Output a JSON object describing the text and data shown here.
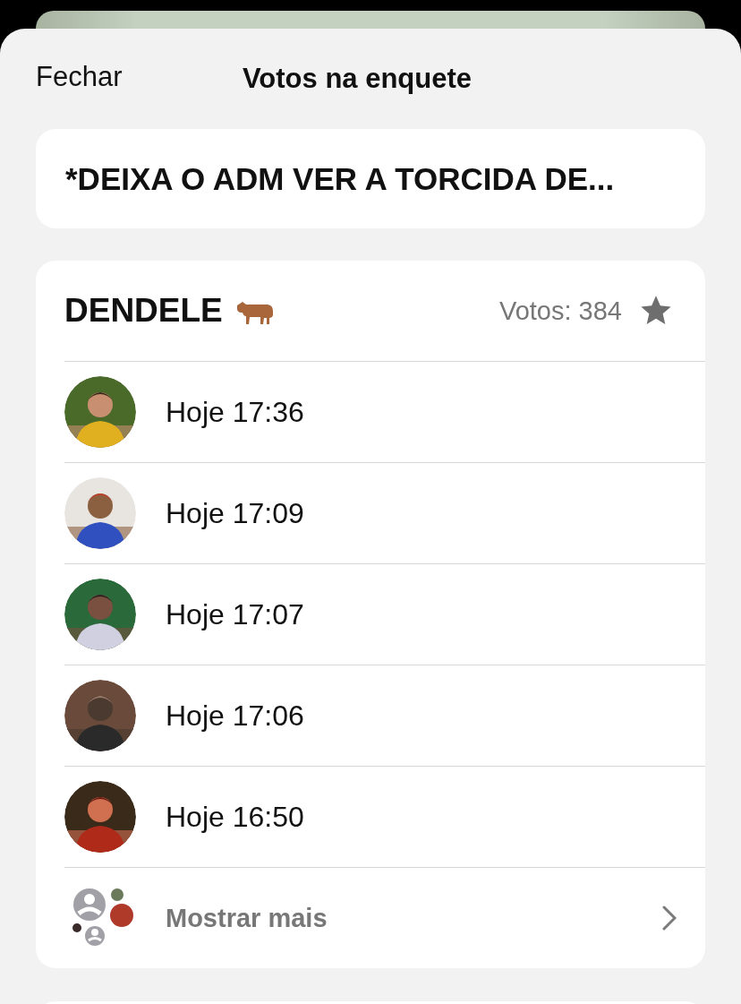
{
  "header": {
    "close": "Fechar",
    "title": "Votos na enquete"
  },
  "question": "*DEIXA O ADM VER A TORCIDA DE...",
  "option": {
    "name": "DENDELE",
    "votes": "Votos: 384",
    "voters": [
      {
        "time": "Hoje 17:36",
        "kind": "picture"
      },
      {
        "time": "Hoje 17:09",
        "kind": "picture"
      },
      {
        "time": "Hoje 17:07",
        "kind": "picture"
      },
      {
        "time": "Hoje 17:06",
        "kind": "picture"
      },
      {
        "time": "Hoje 16:50",
        "kind": "picture"
      }
    ],
    "more": "Mostrar mais"
  }
}
